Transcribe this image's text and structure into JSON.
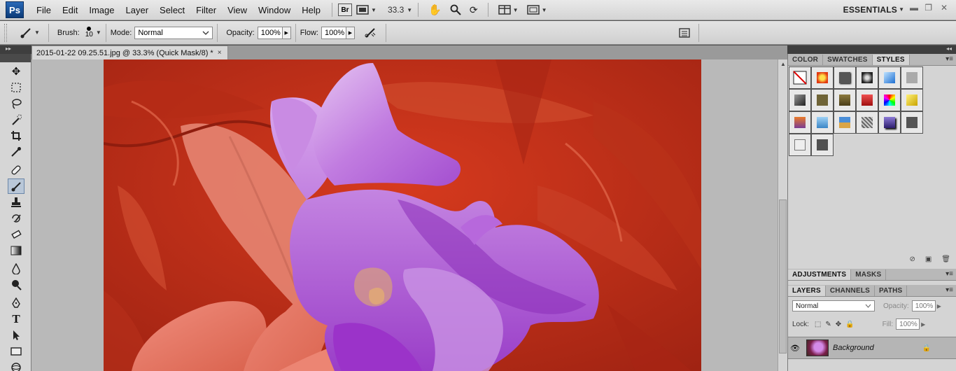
{
  "app": {
    "logo": "Ps"
  },
  "menu": [
    "File",
    "Edit",
    "Image",
    "Layer",
    "Select",
    "Filter",
    "View",
    "Window",
    "Help"
  ],
  "menubar": {
    "bridge_label": "Br",
    "zoom": "33.3",
    "workspace": "ESSENTIALS"
  },
  "options": {
    "brush_label": "Brush:",
    "brush_size": "10",
    "mode_label": "Mode:",
    "mode_value": "Normal",
    "opacity_label": "Opacity:",
    "opacity_value": "100%",
    "flow_label": "Flow:",
    "flow_value": "100%"
  },
  "document": {
    "tab_title": "2015-01-22 09.25.51.jpg @ 33.3% (Quick Mask/8) *",
    "close": "×"
  },
  "panels": {
    "top_tabs": [
      "COLOR",
      "SWATCHES",
      "STYLES"
    ],
    "active_top_tab": "STYLES",
    "adjust_tabs": [
      "ADJUSTMENTS",
      "MASKS"
    ],
    "layer_tabs": [
      "LAYERS",
      "CHANNELS",
      "PATHS"
    ]
  },
  "layers": {
    "blend_mode": "Normal",
    "opacity_label": "Opacity:",
    "opacity_value": "100%",
    "lock_label": "Lock:",
    "fill_label": "Fill:",
    "fill_value": "100%",
    "layer_name": "Background"
  },
  "colors": {
    "quickmask_red": "#c22d16",
    "flower_purple": "#b44fd8",
    "panel_bg": "#d4d4d4"
  }
}
